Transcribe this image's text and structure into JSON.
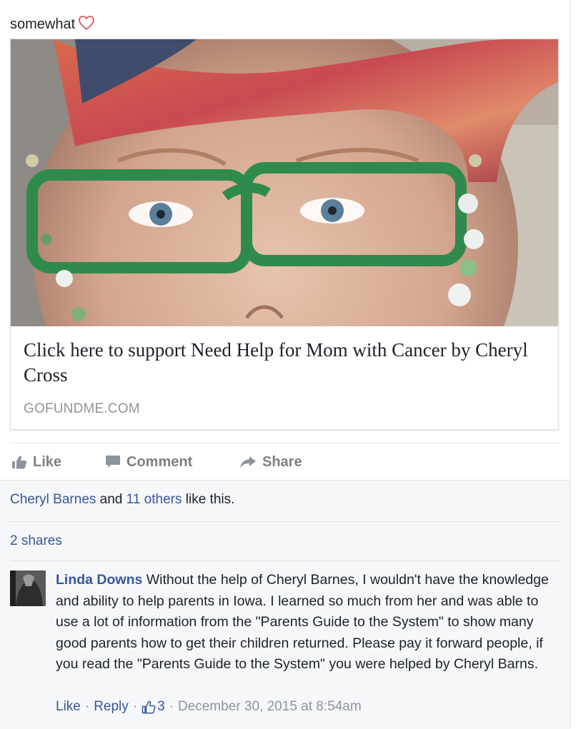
{
  "post": {
    "text_top_partial": "",
    "text_line2": "somewhat"
  },
  "link_card": {
    "title": "Click here to support Need Help for Mom with Cancer by Cheryl Cross",
    "domain": "GOFUNDME.COM"
  },
  "actions": {
    "like": "Like",
    "comment": "Comment",
    "share": "Share"
  },
  "likes": {
    "first_name": "Cheryl Barnes",
    "and": "and",
    "others": "11 others",
    "suffix": "like this."
  },
  "shares": "2 shares",
  "comment": {
    "author": "Linda Downs",
    "text": "Without the help of Cheryl Barnes, I wouldn't have the knowledge and ability to help parents in Iowa. I learned so much from her and was able to use a lot of information from the \"Parents Guide to the System\" to show many good parents how to get their children returned. Please pay it forward people, if you read the \"Parents Guide to the System\" you were helped by Cheryl Barns.",
    "like_label": "Like",
    "reply_label": "Reply",
    "like_count": "3",
    "timestamp": "December 30, 2015 at 8:54am"
  },
  "colors": {
    "link_blue": "#365899",
    "muted_gray": "#90949c",
    "action_gray": "#7f7f7f"
  }
}
